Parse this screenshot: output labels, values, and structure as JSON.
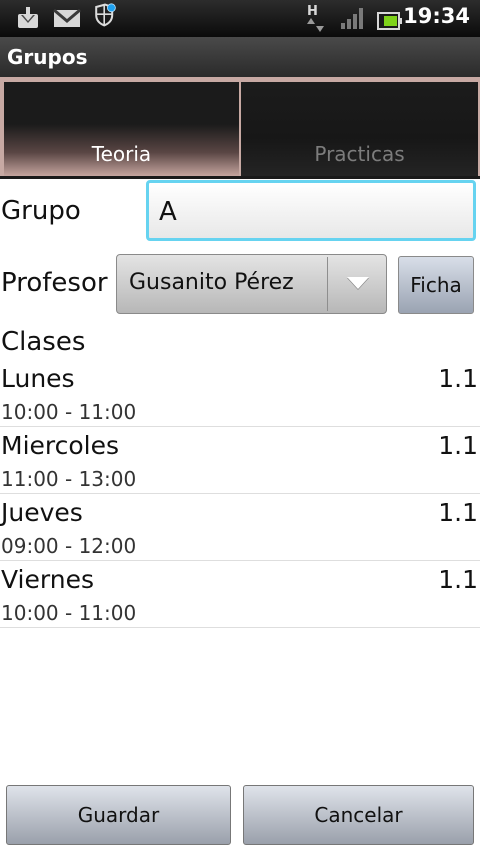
{
  "status_bar": {
    "time": "19:34",
    "network_label": "H",
    "icons": [
      "download-icon",
      "gmail-icon",
      "shield-notification-icon",
      "hspa-network-icon",
      "signal-bars-icon",
      "battery-icon"
    ]
  },
  "app": {
    "title": "Grupos"
  },
  "tabs": [
    {
      "label": "Teoria",
      "active": true
    },
    {
      "label": "Practicas",
      "active": false
    }
  ],
  "form": {
    "grupo_label": "Grupo",
    "grupo_value": "A",
    "profesor_label": "Profesor",
    "profesor_value": "Gusanito Pérez",
    "ficha_label": "Ficha",
    "clases_label": "Clases"
  },
  "clases": [
    {
      "day": "Lunes",
      "time": "10:00 - 11:00",
      "value": "1.1"
    },
    {
      "day": "Miercoles",
      "time": "11:00 - 13:00",
      "value": "1.1"
    },
    {
      "day": "Jueves",
      "time": "09:00 - 12:00",
      "value": "1.1"
    },
    {
      "day": "Viernes",
      "time": "10:00 - 11:00",
      "value": "1.1"
    }
  ],
  "buttons": {
    "save": "Guardar",
    "cancel": "Cancelar"
  },
  "colors": {
    "focus_border": "#66d3f0",
    "tab_accent": "#c7a9a3",
    "notification_dot": "#1ea1f0"
  }
}
